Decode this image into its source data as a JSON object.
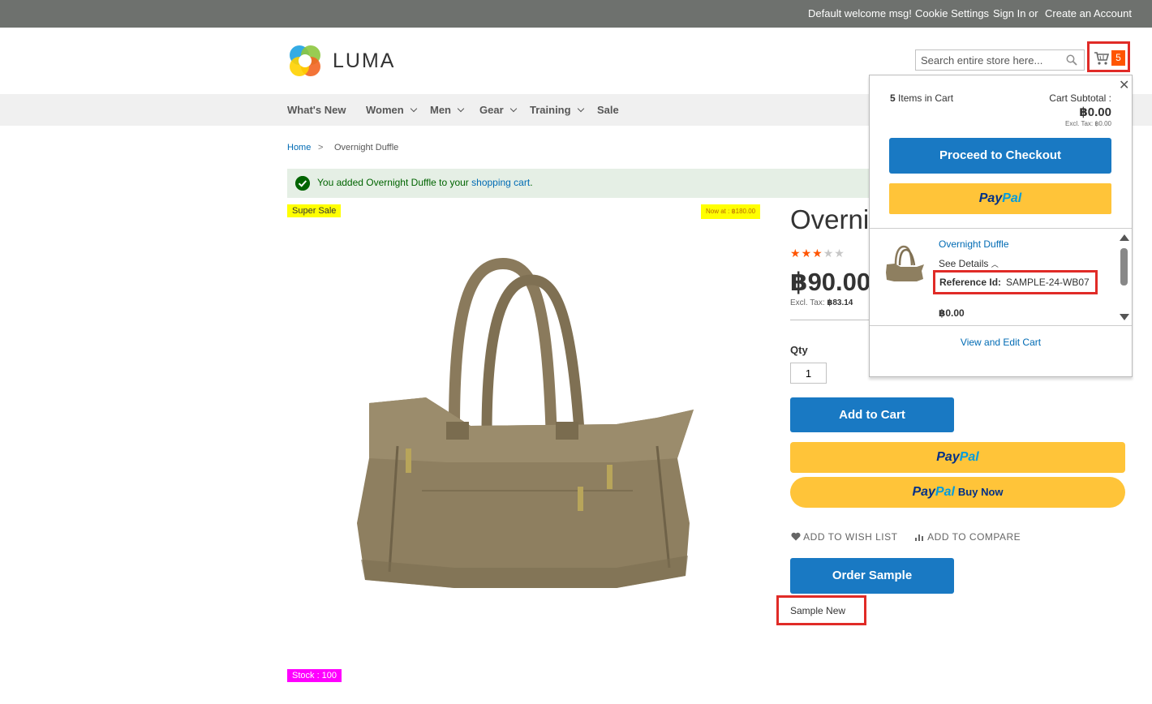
{
  "topbar": {
    "welcome": "Default welcome msg!",
    "cookie": "Cookie Settings",
    "sign_in": "Sign In",
    "or": "or",
    "create_account": "Create an Account"
  },
  "header": {
    "logo_text": "LUMA",
    "search_placeholder": "Search entire store here...",
    "cart_count": "5"
  },
  "nav": {
    "items": [
      {
        "label": "What's New",
        "has_submenu": false
      },
      {
        "label": "Women",
        "has_submenu": true
      },
      {
        "label": "Men",
        "has_submenu": true
      },
      {
        "label": "Gear",
        "has_submenu": true
      },
      {
        "label": "Training",
        "has_submenu": true
      },
      {
        "label": "Sale",
        "has_submenu": false
      }
    ]
  },
  "breadcrumb": {
    "home": "Home",
    "separator": ">",
    "current": "Overnight Duffle"
  },
  "message": {
    "text": "You added Overnight Duffle to your ",
    "link": "shopping cart",
    "suffix": "."
  },
  "badges": {
    "super_sale": "Super Sale",
    "now_at": "Now at : ฿180.00",
    "stock": "Stock : 100"
  },
  "product": {
    "title_visible": "Overni",
    "rating_stars": 3,
    "rating_max": 5,
    "price_visible": "฿90.00",
    "excl_tax_label": "Excl. Tax:",
    "excl_tax_value": "฿83.14",
    "qty_label": "Qty",
    "qty_value": "1",
    "add_to_cart": "Add to Cart",
    "paypal_brand_1": "Pay",
    "paypal_brand_2": "Pal",
    "buy_now": "Buy Now",
    "add_to_wishlist": "ADD TO WISH LIST",
    "add_to_compare": "ADD TO COMPARE",
    "order_sample": "Order Sample",
    "sample_new": "Sample New"
  },
  "minicart": {
    "items_count": "5",
    "items_label": "Items in Cart",
    "subtotal_label": "Cart Subtotal :",
    "subtotal_value": "฿0.00",
    "excl_tax": "Excl. Tax: ฿0.00",
    "checkout": "Proceed to Checkout",
    "item": {
      "name": "Overnight Duffle",
      "see_details": "See Details",
      "ref_label": "Reference Id:",
      "ref_value": "SAMPLE-24-WB07",
      "price": "฿0.00"
    },
    "view_cart": "View and Edit Cart"
  },
  "colors": {
    "primary_blue": "#1979c3",
    "paypal_yellow": "#ffc439",
    "cart_badge": "#ff5501",
    "highlight_red": "#e02b27",
    "success_bg": "#e5efe5",
    "star_filled": "#ff5501"
  }
}
